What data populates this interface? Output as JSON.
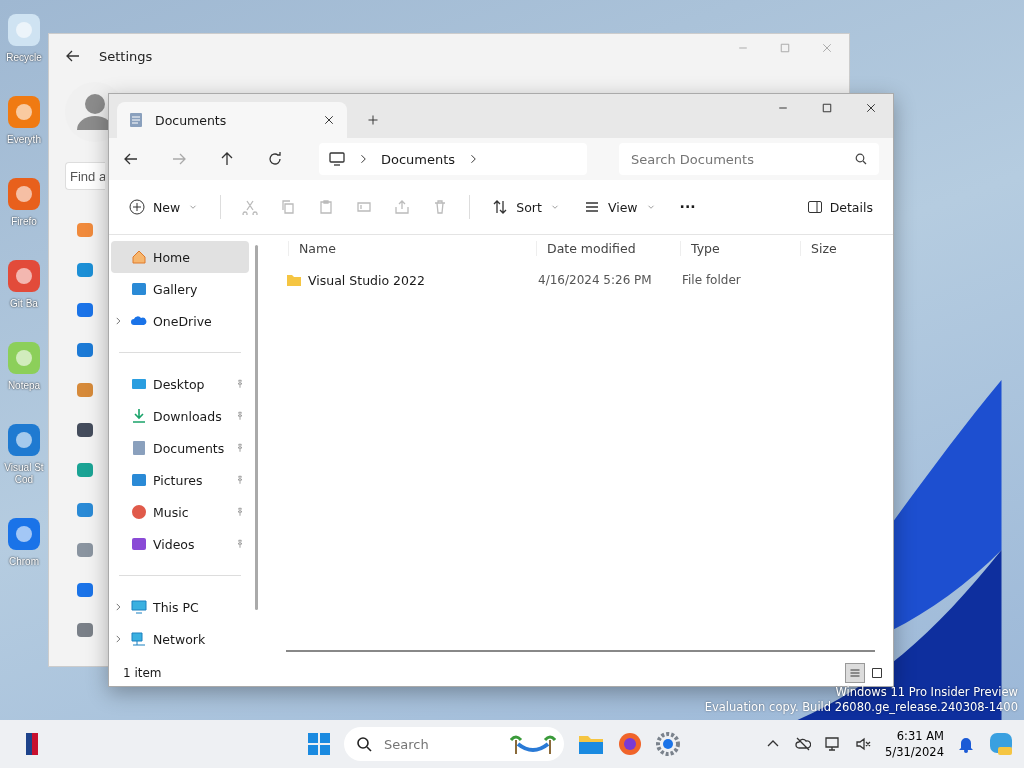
{
  "desktop_icons": [
    {
      "label": "Recycle"
    },
    {
      "label": "Everyth"
    },
    {
      "label": "Firefo"
    },
    {
      "label": "Git Ba"
    },
    {
      "label": "Notepa"
    },
    {
      "label": "Visual St\nCod"
    },
    {
      "label": "Chrom"
    }
  ],
  "settings_window": {
    "title": "Settings",
    "search": {
      "placeholder": "Find a"
    }
  },
  "explorer": {
    "tab": {
      "title": "Documents"
    },
    "breadcrumb": [
      "Documents"
    ],
    "search": {
      "placeholder": "Search Documents"
    },
    "commands": {
      "new": "New",
      "sort": "Sort",
      "view": "View",
      "more": "···",
      "details": "Details"
    },
    "nav_groups": [
      [
        {
          "label": "Home",
          "kind": "home",
          "selected": true,
          "expander": false,
          "pinned": false
        },
        {
          "label": "Gallery",
          "kind": "gallery",
          "selected": false,
          "expander": false,
          "pinned": false
        },
        {
          "label": "OneDrive",
          "kind": "onedrive",
          "selected": false,
          "expander": true,
          "pinned": false
        }
      ],
      [
        {
          "label": "Desktop",
          "kind": "desktop",
          "selected": false,
          "expander": false,
          "pinned": true
        },
        {
          "label": "Downloads",
          "kind": "downloads",
          "selected": false,
          "expander": false,
          "pinned": true
        },
        {
          "label": "Documents",
          "kind": "documents",
          "selected": false,
          "expander": false,
          "pinned": true
        },
        {
          "label": "Pictures",
          "kind": "pictures",
          "selected": false,
          "expander": false,
          "pinned": true
        },
        {
          "label": "Music",
          "kind": "music",
          "selected": false,
          "expander": false,
          "pinned": true
        },
        {
          "label": "Videos",
          "kind": "videos",
          "selected": false,
          "expander": false,
          "pinned": true
        }
      ],
      [
        {
          "label": "This PC",
          "kind": "thispc",
          "selected": false,
          "expander": true,
          "pinned": false
        },
        {
          "label": "Network",
          "kind": "network",
          "selected": false,
          "expander": true,
          "pinned": false
        }
      ]
    ],
    "columns": [
      "Name",
      "Date modified",
      "Type",
      "Size"
    ],
    "rows": [
      {
        "name": "Visual Studio 2022",
        "date": "4/16/2024 5:26 PM",
        "type": "File folder",
        "size": ""
      }
    ],
    "status": "1 item",
    "view_modes": [
      {
        "kind": "details",
        "selected": true
      },
      {
        "kind": "tiles",
        "selected": false
      }
    ]
  },
  "watermark": [
    "Windows 11 Pro Insider Preview",
    "Evaluation copy. Build 26080.ge_release.240308-1400"
  ],
  "taskbar": {
    "search": {
      "placeholder": "Search"
    },
    "time": "6:31 AM",
    "date": "5/31/2024"
  }
}
